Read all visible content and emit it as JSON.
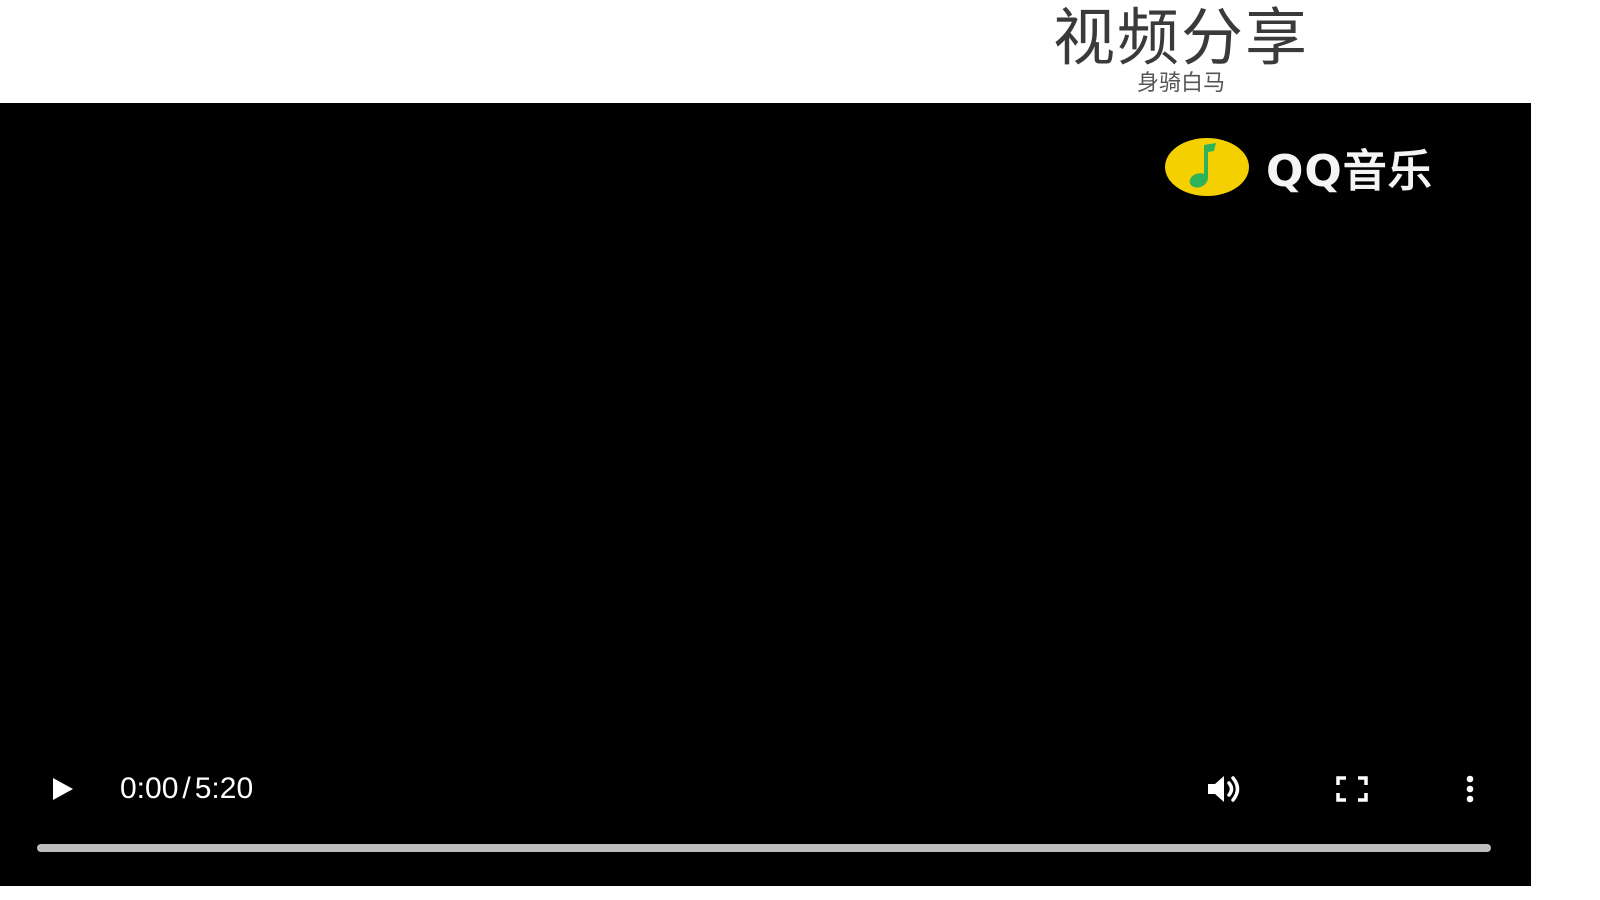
{
  "header": {
    "title": "视频分享",
    "subtitle": "身骑白马"
  },
  "player": {
    "logo_text": "QQ音乐",
    "logo_icon": "qq-music-logo-icon",
    "current_time": "0:00",
    "separator": "/",
    "duration": "5:20",
    "progress": 0,
    "controls": {
      "play_icon": "play-icon",
      "volume_icon": "volume-icon",
      "fullscreen_icon": "fullscreen-icon",
      "more_icon": "more-vertical-icon"
    }
  },
  "colors": {
    "player_background": "#000000",
    "logo_yellow": "#f5d000",
    "logo_green": "#2fb35a",
    "track": "#bdbdbd",
    "text": "#ffffff",
    "title": "#3a3a3a"
  }
}
